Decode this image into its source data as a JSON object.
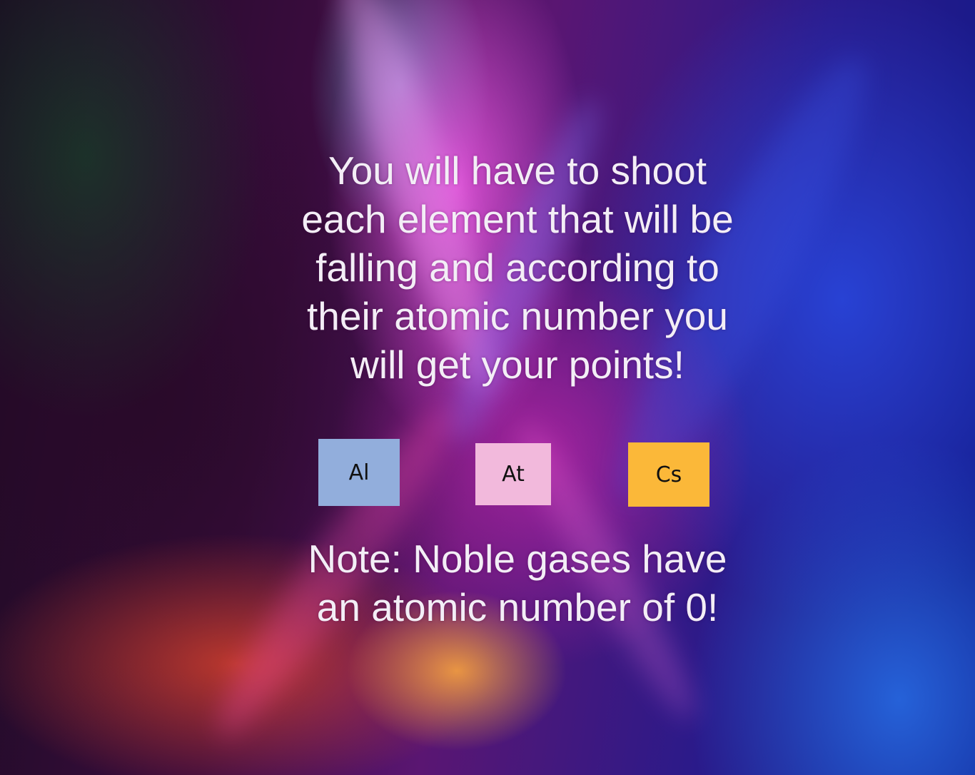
{
  "instructions": {
    "line1": "You will have to shoot",
    "line2": "each element that will be",
    "line3": "falling and according to",
    "line4": "their atomic number you",
    "line5": "will get your points!"
  },
  "examples": [
    {
      "symbol": "Al",
      "color": "#92aedc"
    },
    {
      "symbol": "At",
      "color": "#f2b9dc"
    },
    {
      "symbol": "Cs",
      "color": "#fbb839"
    }
  ],
  "note": {
    "line1": "Note: Noble gases have",
    "line2": "an atomic number of 0!"
  }
}
